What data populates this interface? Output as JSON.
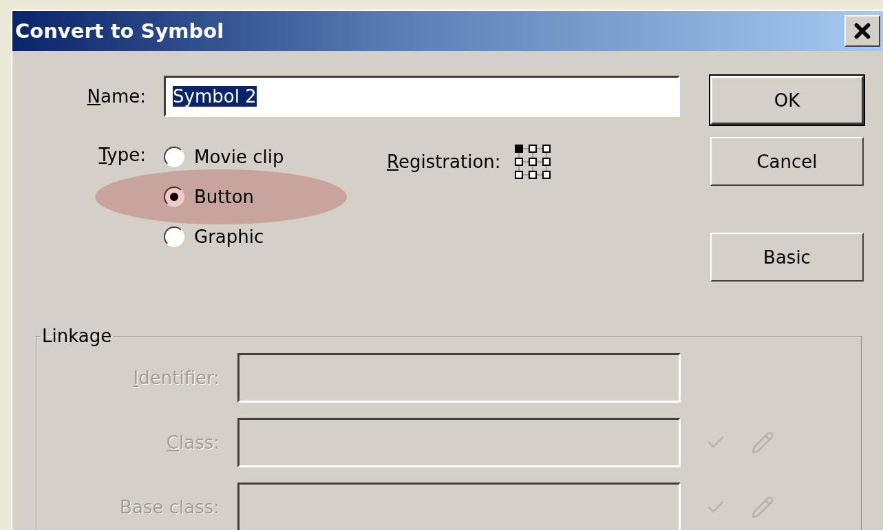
{
  "window": {
    "title": "Convert to Symbol"
  },
  "name": {
    "label": "Name:",
    "underline_first": true,
    "value": "Symbol 2",
    "selected": true
  },
  "type": {
    "label": "Type:",
    "underline_first": true,
    "options": [
      {
        "label": "Movie clip",
        "selected": false,
        "highlighted": false
      },
      {
        "label": "Button",
        "selected": true,
        "highlighted": true
      },
      {
        "label": "Graphic",
        "selected": false,
        "highlighted": false
      }
    ]
  },
  "registration": {
    "label": "Registration:",
    "underline_first": true
  },
  "buttons": [
    {
      "label": "OK",
      "default": true
    },
    {
      "label": "Cancel",
      "default": false
    },
    {
      "label": "Basic",
      "default": false
    }
  ],
  "linkage": {
    "title": "Linkage",
    "fields": [
      {
        "label": "Identifier:",
        "underline_first": true,
        "disabled": true,
        "tools": false
      },
      {
        "label": "Class:",
        "underline_first": true,
        "disabled": true,
        "tools": true
      },
      {
        "label": "Base class:",
        "underline_first": false,
        "disabled": true,
        "tools": true
      }
    ]
  }
}
